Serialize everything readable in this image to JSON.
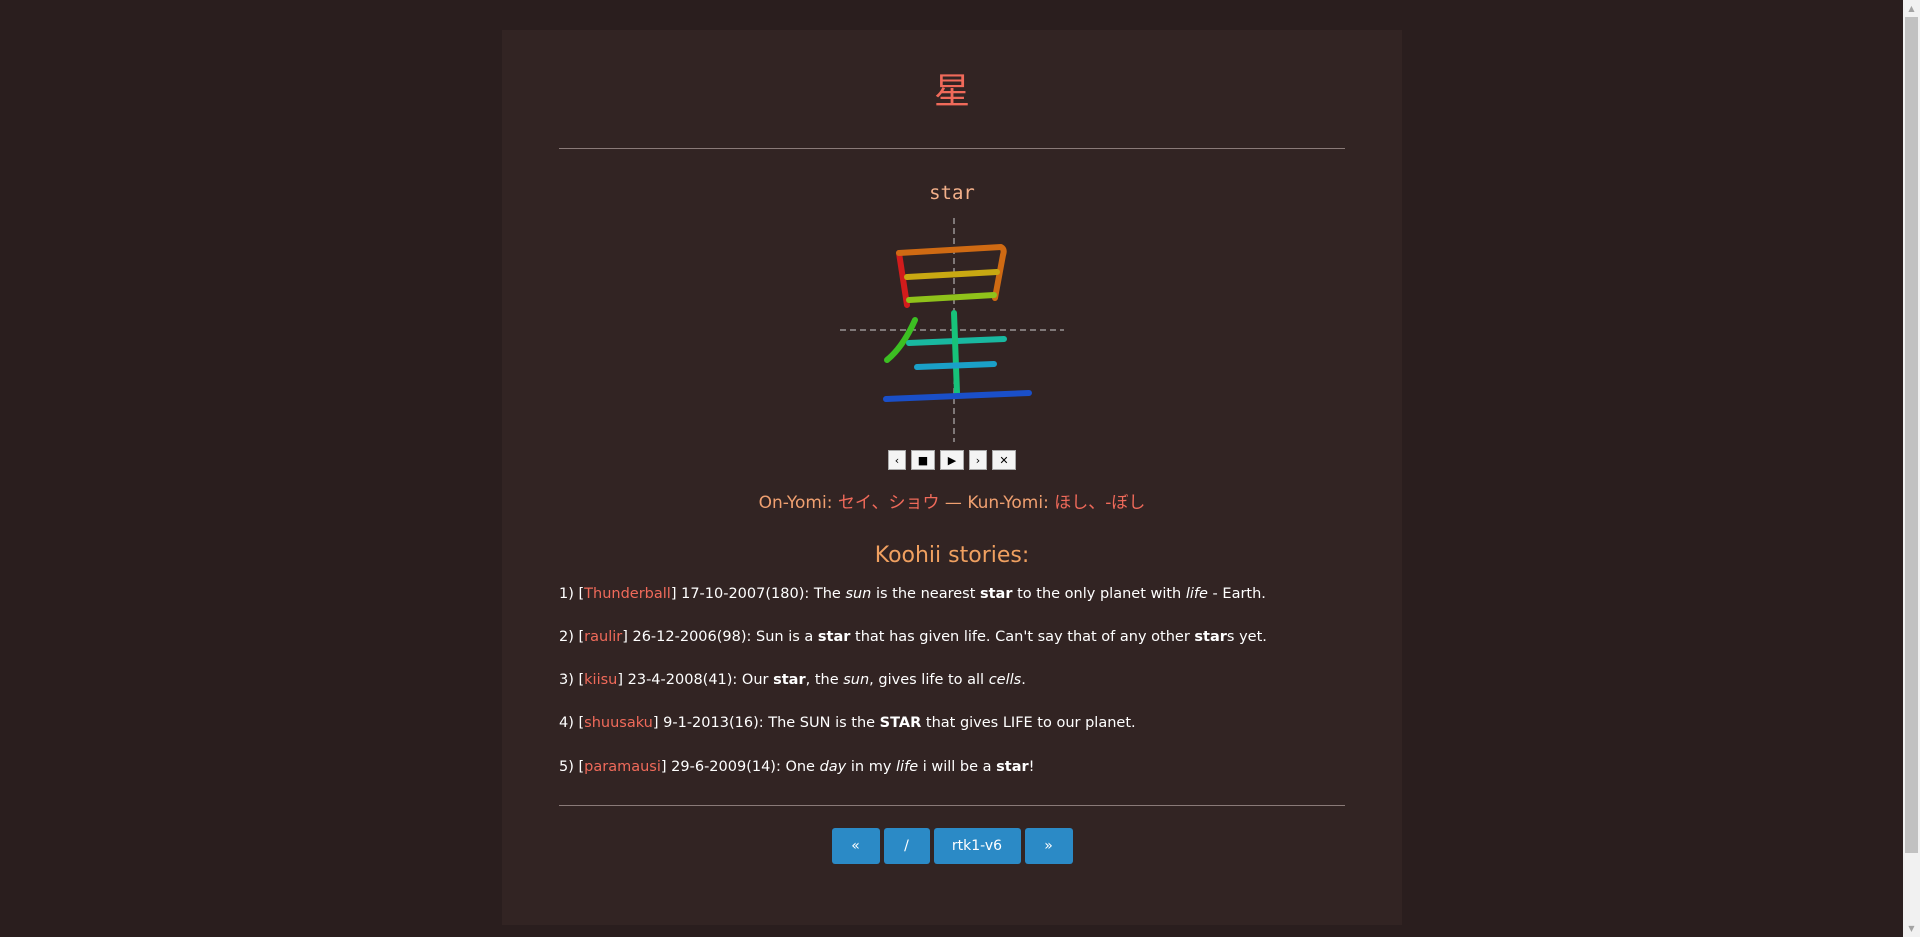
{
  "kanji": "星",
  "keyword": "star",
  "controls": {
    "prev": "‹",
    "stop": "■",
    "play": "▶",
    "next": "›",
    "close": "✕"
  },
  "readings": {
    "on_label": "On-Yomi:",
    "on_value": "セイ、ショウ",
    "separator": "—",
    "kun_label": "Kun-Yomi:",
    "kun_value": "ほし、-ぼし"
  },
  "stories_title": "Koohii stories:",
  "stories": [
    {
      "num": "1) [",
      "user": "Thunderball",
      "meta": "] 17-10-2007(180): The ",
      "p": [
        "sun",
        " is the nearest ",
        "star",
        " to the only planet with ",
        "life",
        " - Earth."
      ]
    },
    {
      "num": "2) [",
      "user": "raulir",
      "meta": "] 26-12-2006(98): Sun is a ",
      "p": [
        "star",
        " that has given life. Can't say that of any other ",
        "star",
        "s yet."
      ]
    },
    {
      "num": "3) [",
      "user": "kiisu",
      "meta": "] 23-4-2008(41): Our ",
      "p": [
        "star",
        ", the ",
        "sun",
        ", gives life to all ",
        "cells",
        "."
      ]
    },
    {
      "num": "4) [",
      "user": "shuusaku",
      "meta": "] 9-1-2013(16): The SUN is the ",
      "p": [
        "STAR",
        " that gives LIFE to our planet."
      ]
    },
    {
      "num": "5) [",
      "user": "paramausi",
      "meta": "] 29-6-2009(14): One ",
      "p": [
        "day",
        " in my ",
        "life",
        " i will be a ",
        "star",
        "!"
      ]
    }
  ],
  "nav": {
    "prev": "«",
    "index": "/",
    "current": "rtk1-v6",
    "next": "»"
  },
  "colors": {
    "background": "#2a1e1e",
    "panel": "#322423",
    "accent_red": "#f06a5a",
    "accent_orange": "#f0a060",
    "button_blue": "#2b8ac6"
  },
  "icons": {
    "scroll_up": "▲",
    "scroll_down": "▼"
  }
}
